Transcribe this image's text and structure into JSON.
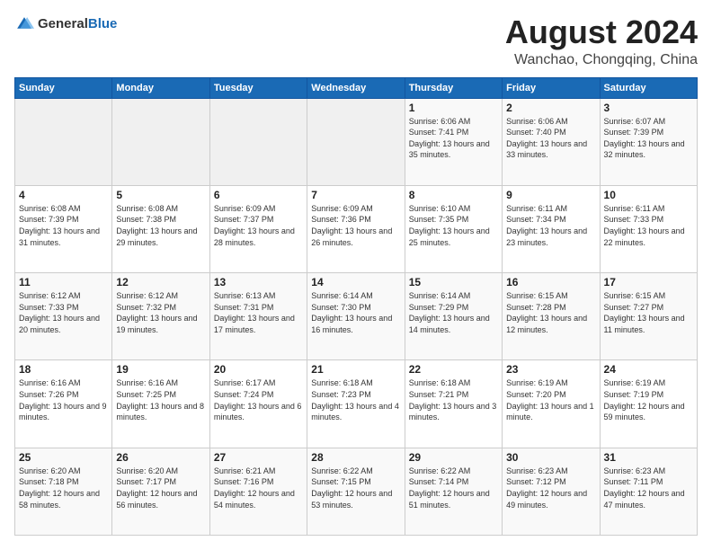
{
  "logo": {
    "general": "General",
    "blue": "Blue"
  },
  "header": {
    "month_year": "August 2024",
    "location": "Wanchao, Chongqing, China"
  },
  "weekdays": [
    "Sunday",
    "Monday",
    "Tuesday",
    "Wednesday",
    "Thursday",
    "Friday",
    "Saturday"
  ],
  "weeks": [
    [
      {
        "day": "",
        "sunrise": "",
        "sunset": "",
        "daylight": ""
      },
      {
        "day": "",
        "sunrise": "",
        "sunset": "",
        "daylight": ""
      },
      {
        "day": "",
        "sunrise": "",
        "sunset": "",
        "daylight": ""
      },
      {
        "day": "",
        "sunrise": "",
        "sunset": "",
        "daylight": ""
      },
      {
        "day": "1",
        "sunrise": "6:06 AM",
        "sunset": "7:41 PM",
        "daylight": "13 hours and 35 minutes."
      },
      {
        "day": "2",
        "sunrise": "6:06 AM",
        "sunset": "7:40 PM",
        "daylight": "13 hours and 33 minutes."
      },
      {
        "day": "3",
        "sunrise": "6:07 AM",
        "sunset": "7:39 PM",
        "daylight": "13 hours and 32 minutes."
      }
    ],
    [
      {
        "day": "4",
        "sunrise": "6:08 AM",
        "sunset": "7:39 PM",
        "daylight": "13 hours and 31 minutes."
      },
      {
        "day": "5",
        "sunrise": "6:08 AM",
        "sunset": "7:38 PM",
        "daylight": "13 hours and 29 minutes."
      },
      {
        "day": "6",
        "sunrise": "6:09 AM",
        "sunset": "7:37 PM",
        "daylight": "13 hours and 28 minutes."
      },
      {
        "day": "7",
        "sunrise": "6:09 AM",
        "sunset": "7:36 PM",
        "daylight": "13 hours and 26 minutes."
      },
      {
        "day": "8",
        "sunrise": "6:10 AM",
        "sunset": "7:35 PM",
        "daylight": "13 hours and 25 minutes."
      },
      {
        "day": "9",
        "sunrise": "6:11 AM",
        "sunset": "7:34 PM",
        "daylight": "13 hours and 23 minutes."
      },
      {
        "day": "10",
        "sunrise": "6:11 AM",
        "sunset": "7:33 PM",
        "daylight": "13 hours and 22 minutes."
      }
    ],
    [
      {
        "day": "11",
        "sunrise": "6:12 AM",
        "sunset": "7:33 PM",
        "daylight": "13 hours and 20 minutes."
      },
      {
        "day": "12",
        "sunrise": "6:12 AM",
        "sunset": "7:32 PM",
        "daylight": "13 hours and 19 minutes."
      },
      {
        "day": "13",
        "sunrise": "6:13 AM",
        "sunset": "7:31 PM",
        "daylight": "13 hours and 17 minutes."
      },
      {
        "day": "14",
        "sunrise": "6:14 AM",
        "sunset": "7:30 PM",
        "daylight": "13 hours and 16 minutes."
      },
      {
        "day": "15",
        "sunrise": "6:14 AM",
        "sunset": "7:29 PM",
        "daylight": "13 hours and 14 minutes."
      },
      {
        "day": "16",
        "sunrise": "6:15 AM",
        "sunset": "7:28 PM",
        "daylight": "13 hours and 12 minutes."
      },
      {
        "day": "17",
        "sunrise": "6:15 AM",
        "sunset": "7:27 PM",
        "daylight": "13 hours and 11 minutes."
      }
    ],
    [
      {
        "day": "18",
        "sunrise": "6:16 AM",
        "sunset": "7:26 PM",
        "daylight": "13 hours and 9 minutes."
      },
      {
        "day": "19",
        "sunrise": "6:16 AM",
        "sunset": "7:25 PM",
        "daylight": "13 hours and 8 minutes."
      },
      {
        "day": "20",
        "sunrise": "6:17 AM",
        "sunset": "7:24 PM",
        "daylight": "13 hours and 6 minutes."
      },
      {
        "day": "21",
        "sunrise": "6:18 AM",
        "sunset": "7:23 PM",
        "daylight": "13 hours and 4 minutes."
      },
      {
        "day": "22",
        "sunrise": "6:18 AM",
        "sunset": "7:21 PM",
        "daylight": "13 hours and 3 minutes."
      },
      {
        "day": "23",
        "sunrise": "6:19 AM",
        "sunset": "7:20 PM",
        "daylight": "13 hours and 1 minute."
      },
      {
        "day": "24",
        "sunrise": "6:19 AM",
        "sunset": "7:19 PM",
        "daylight": "12 hours and 59 minutes."
      }
    ],
    [
      {
        "day": "25",
        "sunrise": "6:20 AM",
        "sunset": "7:18 PM",
        "daylight": "12 hours and 58 minutes."
      },
      {
        "day": "26",
        "sunrise": "6:20 AM",
        "sunset": "7:17 PM",
        "daylight": "12 hours and 56 minutes."
      },
      {
        "day": "27",
        "sunrise": "6:21 AM",
        "sunset": "7:16 PM",
        "daylight": "12 hours and 54 minutes."
      },
      {
        "day": "28",
        "sunrise": "6:22 AM",
        "sunset": "7:15 PM",
        "daylight": "12 hours and 53 minutes."
      },
      {
        "day": "29",
        "sunrise": "6:22 AM",
        "sunset": "7:14 PM",
        "daylight": "12 hours and 51 minutes."
      },
      {
        "day": "30",
        "sunrise": "6:23 AM",
        "sunset": "7:12 PM",
        "daylight": "12 hours and 49 minutes."
      },
      {
        "day": "31",
        "sunrise": "6:23 AM",
        "sunset": "7:11 PM",
        "daylight": "12 hours and 47 minutes."
      }
    ]
  ],
  "daylight_label": "Daylight hours",
  "sunrise_label": "Sunrise:",
  "sunset_label": "Sunset:"
}
